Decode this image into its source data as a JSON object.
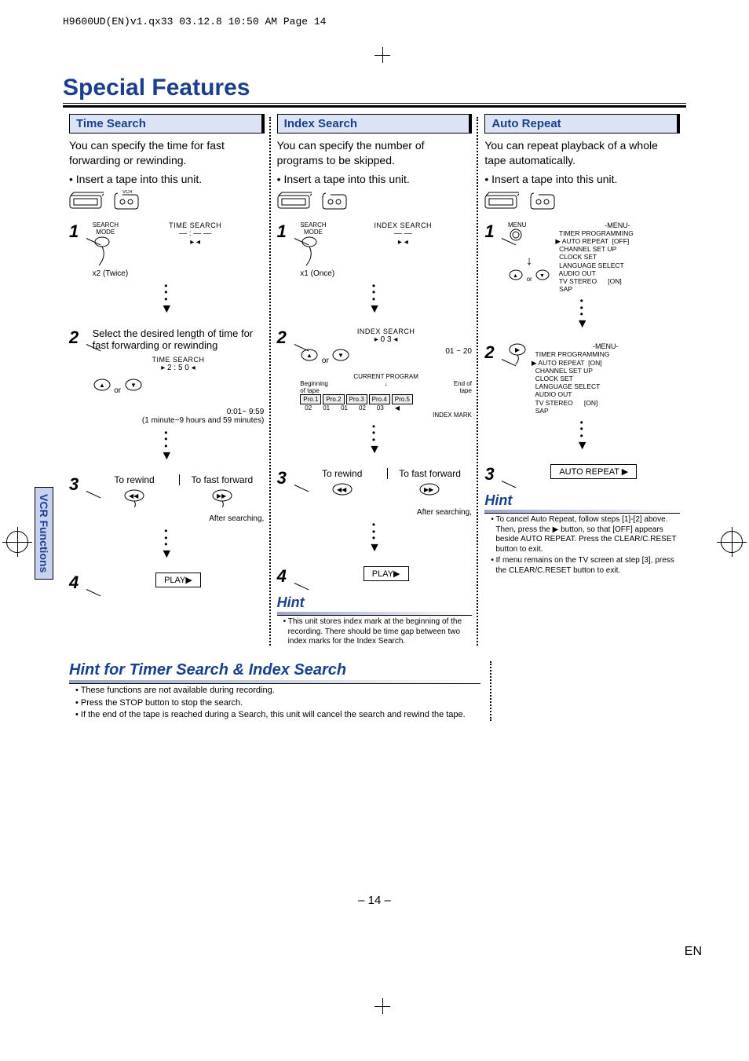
{
  "meta": {
    "header": "H9600UD(EN)v1.qx33  03.12.8  10:50 AM  Page 14"
  },
  "title": "Special Features",
  "sideTab": "VCR Functions",
  "pageNum": "– 14 –",
  "enLabel": "EN",
  "common": {
    "insert": "• Insert a tape into this unit.",
    "afterSearching": "After searching,",
    "or": "or",
    "play": "PLAY▶",
    "toRewind": "To rewind",
    "toFF": "To fast forward"
  },
  "timeSearch": {
    "head": "Time Search",
    "intro": "You can specify the time for fast forwarding or rewinding.",
    "step1Label": "TIME SEARCH",
    "step1Sub": "x2 (Twice)",
    "btnSmall": "SEARCH\nMODE",
    "step2Text": "Select the desired length of time for fast forwarding or rewinding",
    "step2Label": "TIME SEARCH",
    "step2Value": "2 : 5 0",
    "step2Range": "0:01~ 9:59",
    "step2RangeNote": "(1 minute~9 hours and 59 minutes)"
  },
  "indexSearch": {
    "head": "Index Search",
    "intro": "You can specify the number of programs to be skipped.",
    "step1Label": "INDEX SEARCH",
    "step1Sub": "x1 (Once)",
    "step2Label": "INDEX SEARCH",
    "step2Value": "0 3",
    "step2Range": "01 ~ 20",
    "curProg": "CURRENT PROGRAM",
    "beg": "Beginning of tape",
    "end": "End of tape",
    "progs": [
      "Pro.1",
      "Pro.2",
      "Pro.3",
      "Pro.4",
      "Pro.5"
    ],
    "marks": [
      "02",
      "01",
      "01",
      "02",
      "03"
    ],
    "marksLabel": "INDEX MARK",
    "hintHead": "Hint",
    "hint1": "• This unit stores index mark at the beginning of the recording. There should be time gap between two index marks for the Index Search."
  },
  "autoRepeat": {
    "head": "Auto Repeat",
    "intro": "You can repeat playback of a whole tape automatically.",
    "menuBtn": "MENU",
    "menuTitle": "-MENU-",
    "menu1": "  TIMER PROGRAMMING\n▶ AUTO REPEAT  [OFF]\n  CHANNEL SET UP\n  CLOCK SET\n  LANGUAGE SELECT\n  AUDIO OUT\n  TV STEREO      [ON]\n  SAP",
    "menu2": "  TIMER PROGRAMMING\n▶ AUTO REPEAT  [ON]\n  CHANNEL SET UP\n  CLOCK SET\n  LANGUAGE SELECT\n  AUDIO OUT\n  TV STEREO      [ON]\n  SAP",
    "step3Box": "AUTO REPEAT ▶",
    "hintHead": "Hint",
    "hint1": "• To cancel Auto Repeat, follow steps [1]-[2] above. Then, press the ▶ button, so that [OFF] appears beside AUTO REPEAT.  Press the CLEAR/C.RESET button to exit.",
    "hint2": "• If menu remains on the TV screen at step [3], press the CLEAR/C.RESET button to exit."
  },
  "footerHint": {
    "head": "Hint for Timer Search & Index Search",
    "b1": "• These functions are not available during recording.",
    "b2": "• Press the STOP button to stop the search.",
    "b3": "• If the end of the tape is reached during a Search, this unit will cancel the search and rewind the tape."
  }
}
